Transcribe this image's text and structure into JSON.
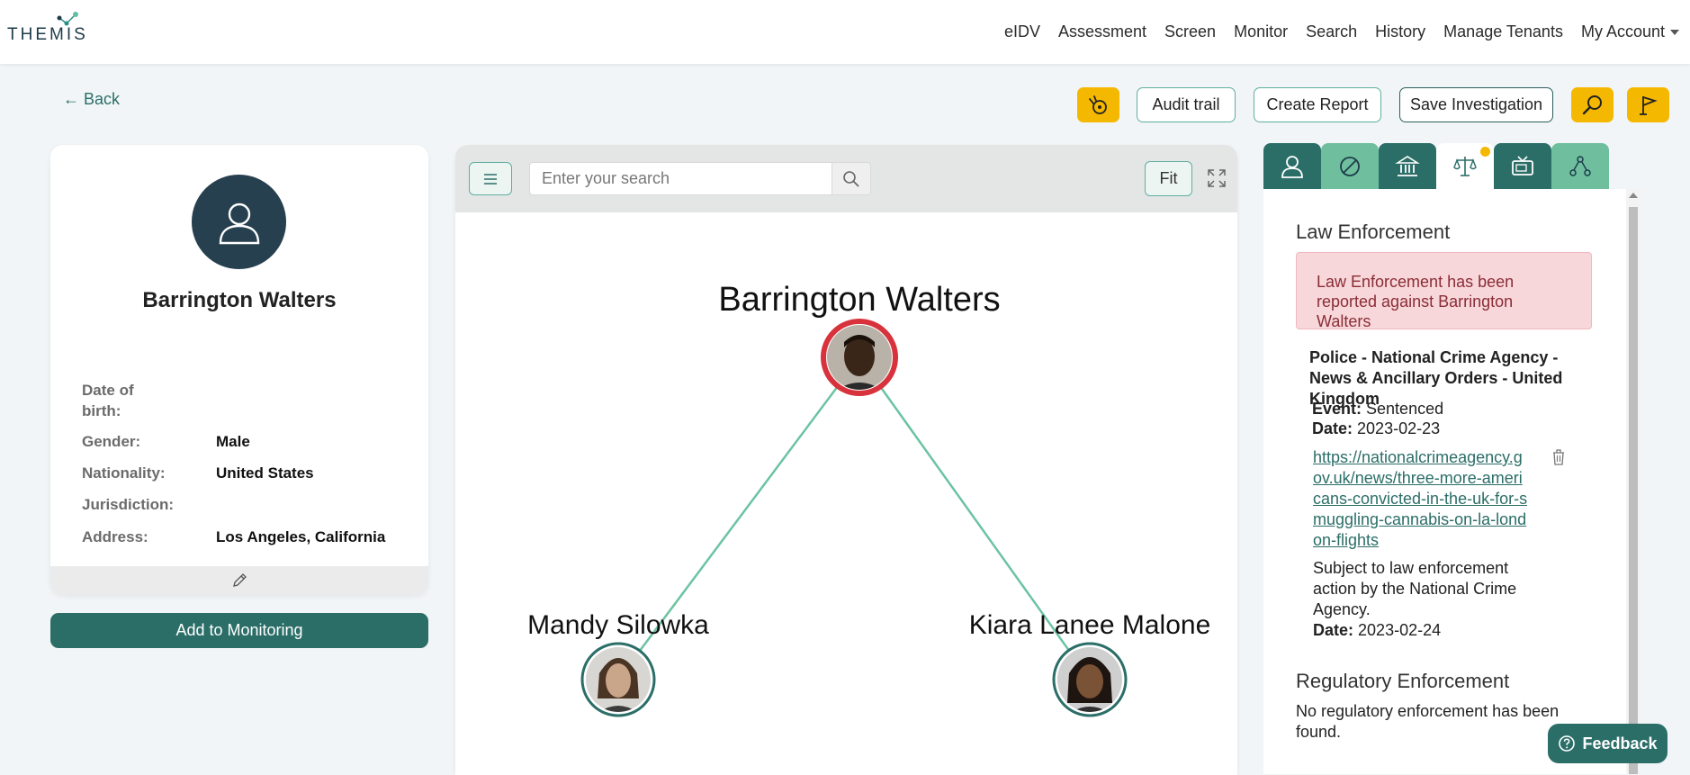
{
  "app": {
    "logo_text": "THEMIS"
  },
  "nav": {
    "items": [
      "eIDV",
      "Assessment",
      "Screen",
      "Monitor",
      "Search",
      "History",
      "Manage Tenants"
    ],
    "account": "My Account"
  },
  "back_label": "← Back",
  "toolbar": {
    "audit_trail": "Audit trail",
    "create_report": "Create Report",
    "save_investigation": "Save Investigation"
  },
  "profile": {
    "name": "Barrington Walters",
    "fields": [
      {
        "label": "Date of birth:",
        "value": ""
      },
      {
        "label": "Gender:",
        "value": "Male"
      },
      {
        "label": "Nationality:",
        "value": "United States"
      },
      {
        "label": "Jurisdiction:",
        "value": ""
      },
      {
        "label": "Address:",
        "value": "Los Angeles, California"
      }
    ],
    "monitor_button": "Add to Monitoring"
  },
  "graph": {
    "search_placeholder": "Enter your search",
    "fit_label": "Fit",
    "nodes": [
      {
        "name": "Barrington Walters",
        "role": "subject"
      },
      {
        "name": "Mandy Silowka",
        "role": "associate"
      },
      {
        "name": "Kiara Lanee Malone",
        "role": "associate"
      }
    ],
    "colors": {
      "edge": "#6cc3a2",
      "subject_ring": "#d8323c",
      "associate_ring": "#2b6e68"
    }
  },
  "right_panel": {
    "tabs": [
      {
        "icon": "person-icon",
        "active": false
      },
      {
        "icon": "ban-icon",
        "active": false
      },
      {
        "icon": "bank-icon",
        "active": false
      },
      {
        "icon": "scales-icon",
        "active": true
      },
      {
        "icon": "tv-icon",
        "active": false
      },
      {
        "icon": "network-icon",
        "active": false
      }
    ],
    "law_title": "Law Enforcement",
    "law_alert": "Law Enforcement has been reported against Barrington Walters",
    "entry": {
      "title": "Police - National Crime Agency - News & Ancillary Orders - United Kingdom",
      "event_label": "Event:",
      "event_value": "Sentenced",
      "date_label": "Date:",
      "date_value": "2023-02-23",
      "link": "https://nationalcrimeagency.gov.uk/news/three-more-americans-convicted-in-the-uk-for-smuggling-cannabis-on-la-london-flights",
      "description": "Subject to law enforcement action by the National Crime Agency.",
      "date2_label": "Date:",
      "date2_value": "2023-02-24"
    },
    "reg_title": "Regulatory Enforcement",
    "reg_text": "No regulatory enforcement has been found."
  },
  "feedback_label": "Feedback",
  "colors": {
    "brand": "#2b6e68",
    "accent": "#f5b800",
    "alert_bg": "#f8d7da"
  }
}
